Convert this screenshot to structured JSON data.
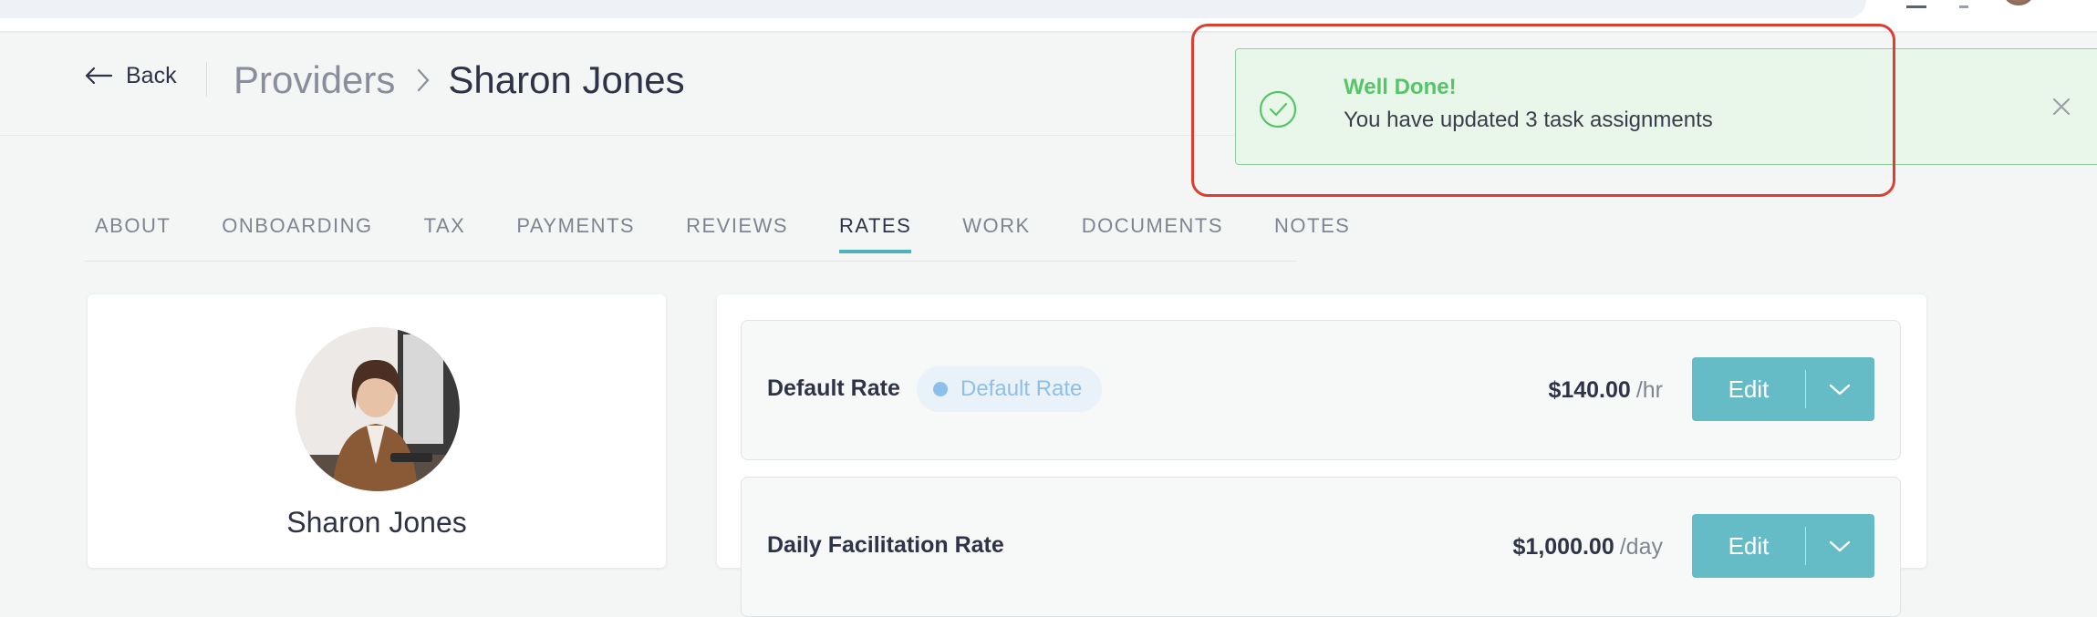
{
  "header": {
    "back_label": "Back",
    "breadcrumb": {
      "parent": "Providers",
      "current": "Sharon Jones"
    }
  },
  "tabs": [
    {
      "label": "ABOUT"
    },
    {
      "label": "ONBOARDING"
    },
    {
      "label": "TAX"
    },
    {
      "label": "PAYMENTS"
    },
    {
      "label": "REVIEWS"
    },
    {
      "label": "RATES",
      "active": true
    },
    {
      "label": "WORK"
    },
    {
      "label": "DOCUMENTS"
    },
    {
      "label": "NOTES"
    }
  ],
  "profile": {
    "name": "Sharon Jones"
  },
  "rates": [
    {
      "name": "Default Rate",
      "badge": "Default Rate",
      "amount": "$140.00",
      "unit": "/hr",
      "edit_label": "Edit"
    },
    {
      "name": "Daily Facilitation Rate",
      "amount": "$1,000.00",
      "unit": "/day",
      "edit_label": "Edit"
    }
  ],
  "toast": {
    "title": "Well Done!",
    "message": "You have updated 3 task assignments"
  },
  "colors": {
    "accent": "#4fb2bd",
    "button": "#66bcc6",
    "success": "#58c46a",
    "highlight": "#dc3e2f",
    "badge_dot": "#8cbfe9"
  }
}
